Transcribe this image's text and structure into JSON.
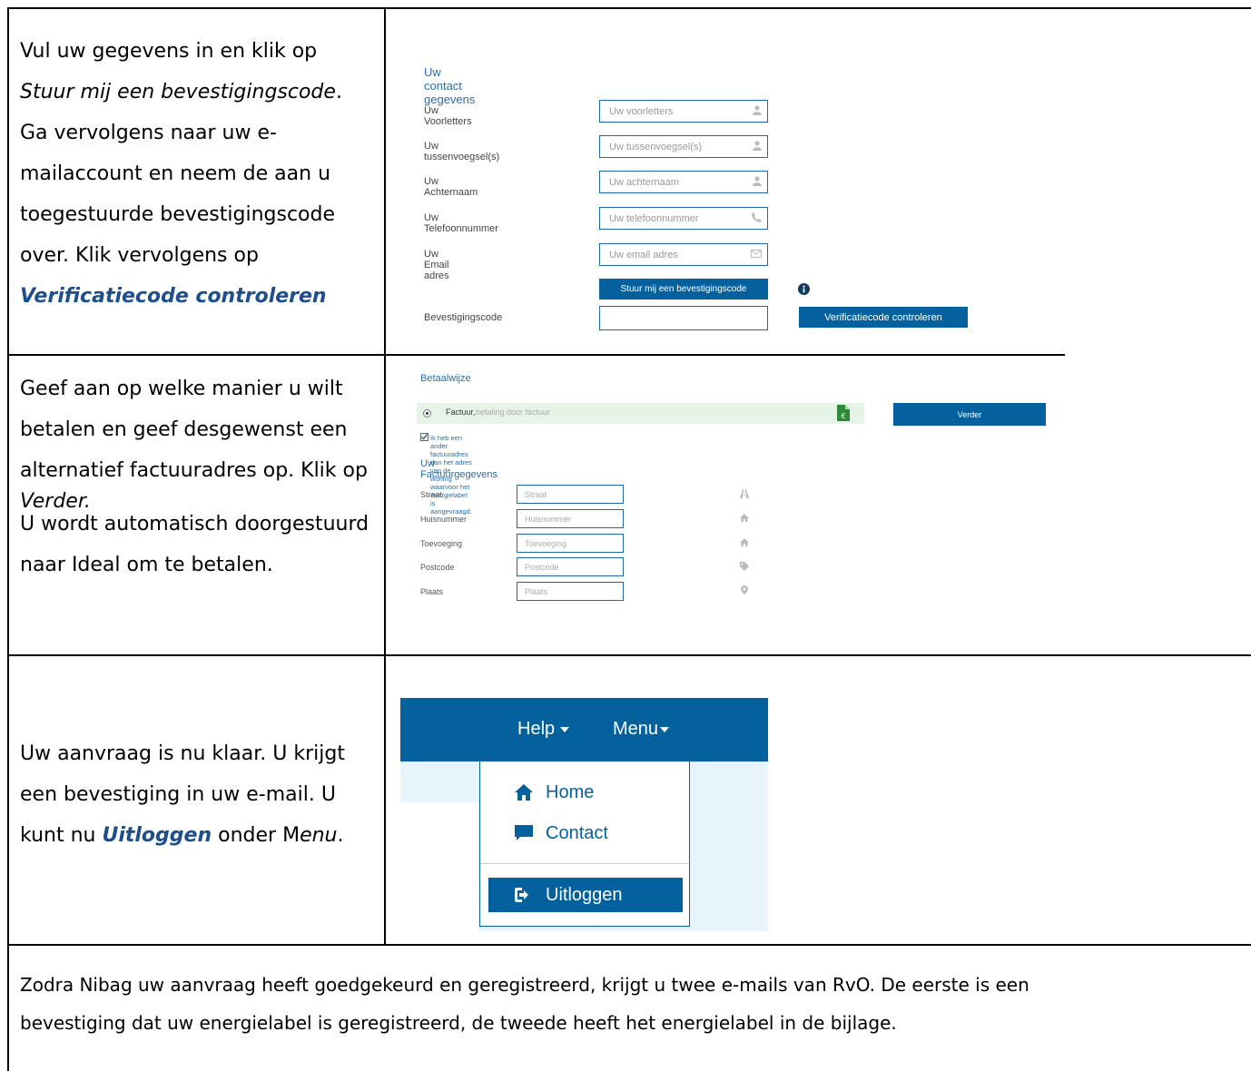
{
  "rows": [
    {
      "instruction": {
        "part1": "Vul uw gegevens in en klik op",
        "part2_italic": "Stuur mij een bevestigingscode",
        "part3": ". Ga vervolgens naar uw e-mailaccount en neem de aan u toegestuurde bevestigingscode over. Klik vervolgens op",
        "link": "Verificatiecode controleren"
      },
      "form": {
        "heading": "Uw contact gegevens",
        "fields": [
          {
            "label": "Uw Voorletters",
            "placeholder": "Uw voorletters",
            "icon": "user-icon"
          },
          {
            "label": "Uw tussenvoegsel(s)",
            "placeholder": "Uw tussenvoegsel(s)",
            "icon": "user-icon"
          },
          {
            "label": "Uw Achternaam",
            "placeholder": "Uw achternaam",
            "icon": "user-icon"
          },
          {
            "label": "Uw Telefoonnummer",
            "placeholder": "Uw telefoonnummer",
            "icon": "phone-icon"
          },
          {
            "label": "Uw Email adres",
            "placeholder": "Uw email adres",
            "icon": "envelope-icon"
          }
        ],
        "send_button": "Stuur mij een bevestigingscode",
        "code_label": "Bevestigingscode",
        "verify_button": "Verificatiecode controleren"
      }
    },
    {
      "instruction": {
        "part1": "Geef aan op welke manier u wilt betalen en geef desgewenst een alternatief factuuradres op. Klik op",
        "part2_italic": "Verder.",
        "part3": "U wordt automatisch doorgestuurd naar Ideal om te betalen."
      },
      "payment": {
        "heading": "Betaalwijze",
        "option_label": "Factuur,",
        "option_desc": "betaling door factuur",
        "next_button": "Verder",
        "checkbox_text": "Ik heb een ander factuuradres dan het adres van de woning waarvoor het energielabel is aangevraagd.",
        "billing_heading": "Uw Factuurgegevens",
        "fields": [
          {
            "label": "Straat",
            "placeholder": "Straat",
            "icon": "road-icon"
          },
          {
            "label": "Huisnummer",
            "placeholder": "Huisnummer",
            "icon": "home-icon"
          },
          {
            "label": "Toevoeging",
            "placeholder": "Toevoeging",
            "icon": "home-icon"
          },
          {
            "label": "Postcode",
            "placeholder": "Postcode",
            "icon": "tag-icon"
          },
          {
            "label": "Plaats",
            "placeholder": "Plaats",
            "icon": "map-marker-icon"
          }
        ]
      }
    },
    {
      "instruction": {
        "part1": "Uw aanvraag is nu klaar. U krijgt een bevestiging in uw e-mail. U kunt nu",
        "link": "Uitloggen",
        "part2": "onder M",
        "part2_italic": "enu",
        "part3": "."
      },
      "menu": {
        "help": "Help",
        "menu": "Menu",
        "items": [
          "Home",
          "Contact",
          "Uitloggen"
        ]
      }
    }
  ],
  "footer_text_line1": "Zodra Nibag uw aanvraag heeft goedgekeurd en geregistreerd, krijgt u twee e-mails van RvO. De eerste is een",
  "footer_text_line2": "bevestiging dat uw energielabel is geregistreerd, de tweede heeft het energielabel in de bijlage."
}
